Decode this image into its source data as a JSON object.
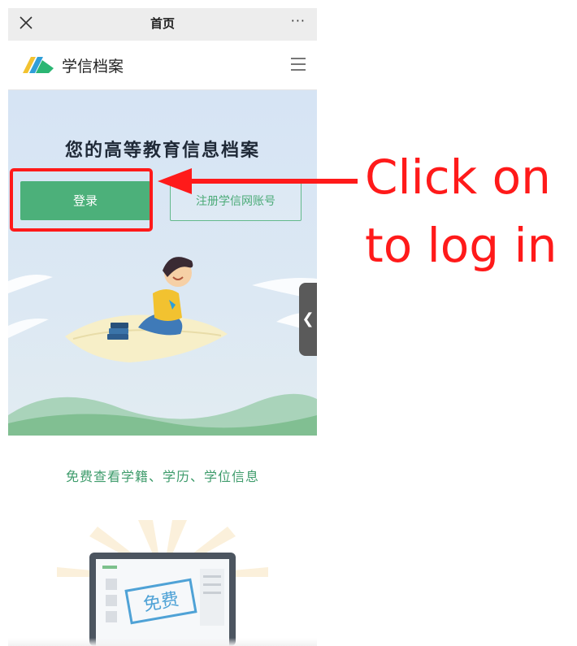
{
  "wechat_bar": {
    "title": "首页",
    "more": "···"
  },
  "site": {
    "logo_text": "学信档案"
  },
  "hero": {
    "title": "您的高等教育信息档案",
    "login_label": "登录",
    "register_label": "注册学信网账号"
  },
  "sections": {
    "subtitle": "免费查看学籍、学历、学位信息",
    "free_badge": "免费"
  },
  "annotation": {
    "line1": "Click on",
    "line2": "to log in"
  },
  "colors": {
    "accent_green": "#4cb07a",
    "annotation_red": "#ff1a1a",
    "hero_bg": "#d6e4f4"
  }
}
